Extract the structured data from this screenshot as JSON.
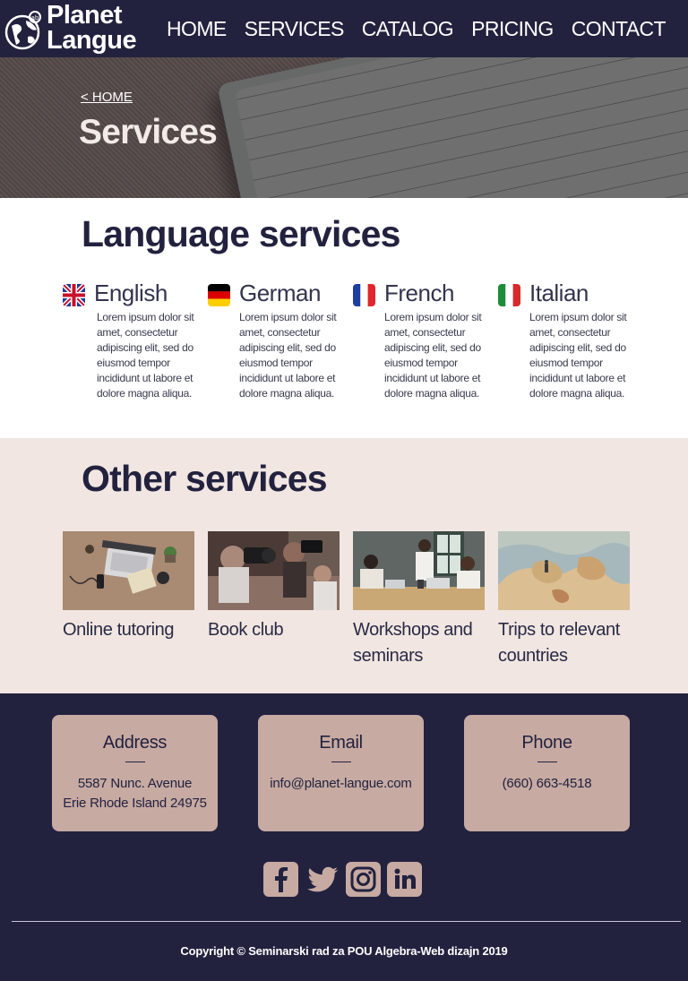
{
  "brand": {
    "line1": "Planet",
    "line2": "Langue"
  },
  "nav": {
    "items": [
      "HOME",
      "SERVICES",
      "CATALOG",
      "PRICING",
      "CONTACT"
    ]
  },
  "hero": {
    "breadcrumb": "<  HOME",
    "title": "Services"
  },
  "language_services": {
    "title": "Language services",
    "items": [
      {
        "name": "English",
        "flag": "uk-flag-icon",
        "text": "Lorem ipsum dolor sit amet, consectetur adipiscing elit, sed do eiusmod tempor incididunt ut labore et dolore magna aliqua."
      },
      {
        "name": "German",
        "flag": "germany-flag-icon",
        "text": "Lorem ipsum dolor sit amet, consectetur adipiscing elit, sed do eiusmod tempor incididunt ut labore et dolore magna aliqua."
      },
      {
        "name": "French",
        "flag": "france-flag-icon",
        "text": "Lorem ipsum dolor sit amet, consectetur adipiscing elit, sed do eiusmod tempor incididunt ut labore et dolore magna aliqua."
      },
      {
        "name": "Italian",
        "flag": "italy-flag-icon",
        "text": "Lorem ipsum dolor sit amet, consectetur adipiscing elit, sed do eiusmod tempor incididunt ut labore et dolore magna aliqua."
      }
    ]
  },
  "other_services": {
    "title": "Other services",
    "items": [
      {
        "label": "Online tutoring"
      },
      {
        "label": "Book club"
      },
      {
        "label": "Workshops and seminars"
      },
      {
        "label": "Trips to relevant countries"
      }
    ]
  },
  "contact": {
    "address": {
      "title": "Address",
      "line1": "5587 Nunc. Avenue",
      "line2": "Erie Rhode Island 24975"
    },
    "email": {
      "title": "Email",
      "value": "info@planet-langue.com"
    },
    "phone": {
      "title": "Phone",
      "value": "(660) 663-4518"
    }
  },
  "social": [
    "facebook-icon",
    "twitter-icon",
    "instagram-icon",
    "linkedin-icon"
  ],
  "copyright": "Copyright © Seminarski rad za POU Algebra-Web dizajn 2019",
  "colors": {
    "navy": "#22223f",
    "beige": "#f1e6e1",
    "rose": "#c7aaa2"
  }
}
